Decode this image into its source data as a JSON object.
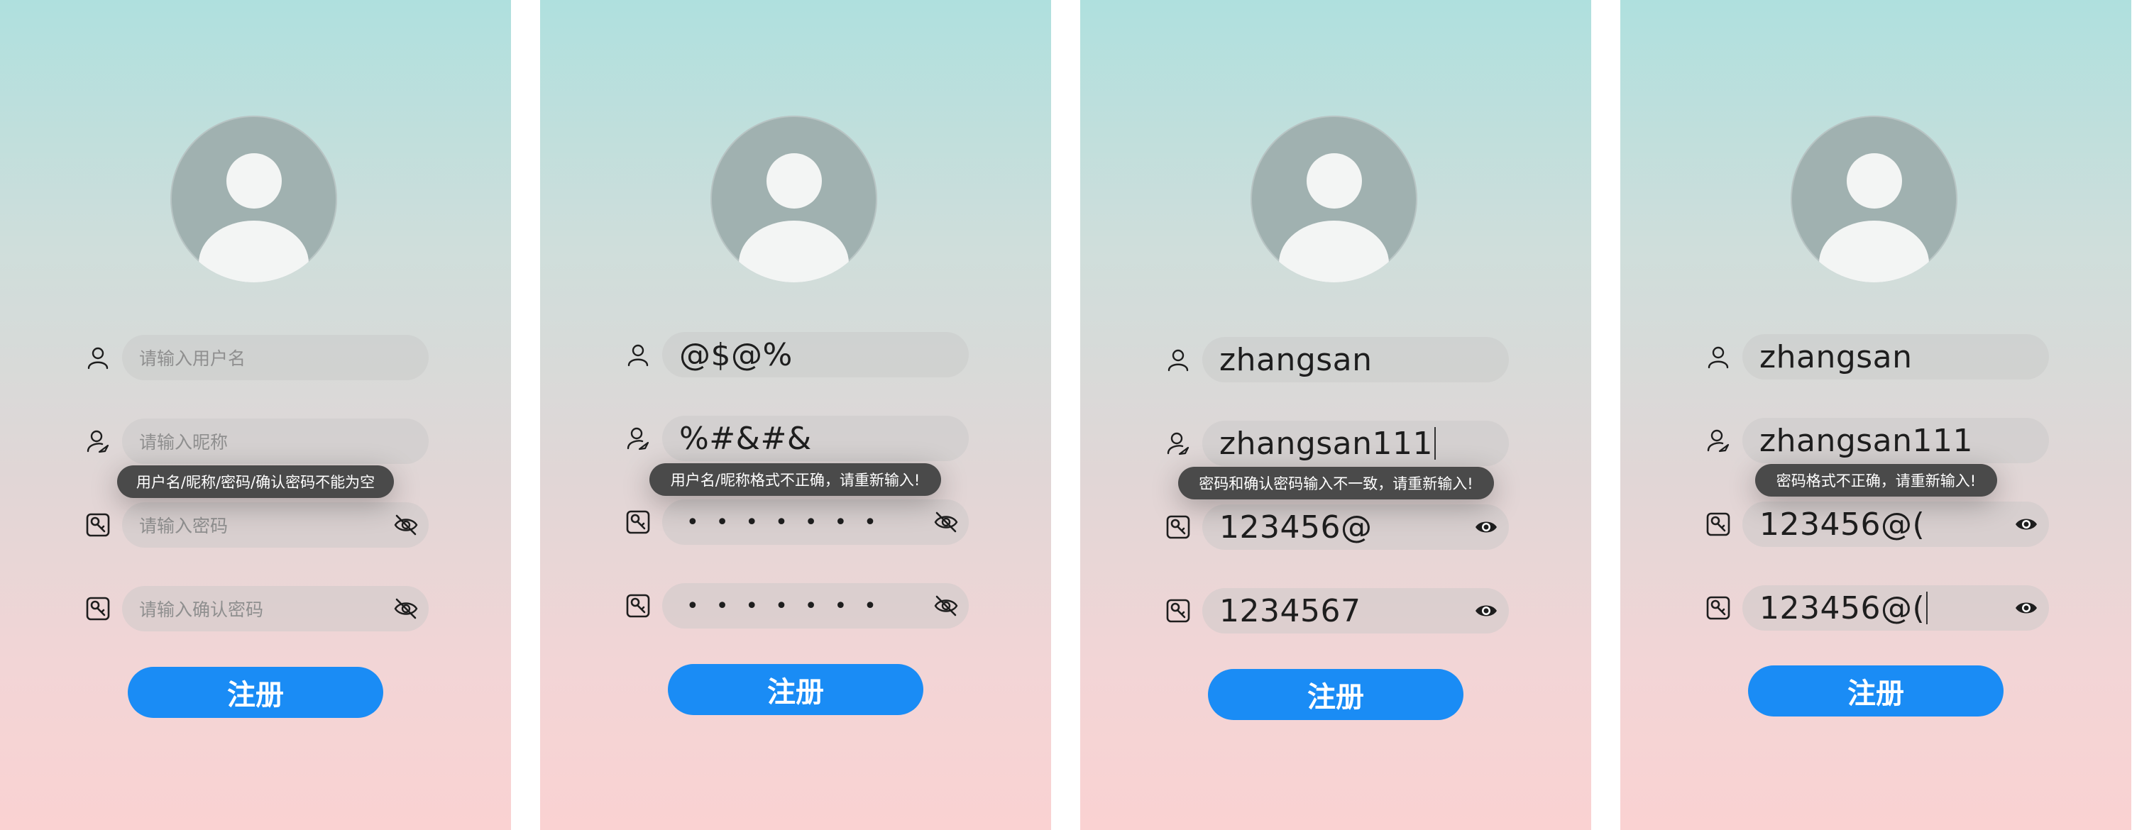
{
  "screens": [
    {
      "fields": [
        {
          "icon": "user-icon",
          "text": "请输入用户名",
          "kind": "placeholder"
        },
        {
          "icon": "user-edit-icon",
          "text": "请输入昵称",
          "kind": "placeholder"
        },
        {
          "icon": "password-icon",
          "text": "请输入密码",
          "kind": "placeholder",
          "eye": "eye-off-icon"
        },
        {
          "icon": "password-icon",
          "text": "请输入确认密码",
          "kind": "placeholder",
          "eye": "eye-off-icon"
        }
      ],
      "toast": "用户名/昵称/密码/确认密码不能为空",
      "button": "注册"
    },
    {
      "fields": [
        {
          "icon": "user-icon",
          "text": "@$@%",
          "kind": "value"
        },
        {
          "icon": "user-edit-icon",
          "text": "%#&#&",
          "kind": "value"
        },
        {
          "icon": "password-icon",
          "text": "•••••••",
          "kind": "masked",
          "eye": "eye-off-icon"
        },
        {
          "icon": "password-icon",
          "text": "•••••••",
          "kind": "masked",
          "eye": "eye-off-icon"
        }
      ],
      "toast": "用户名/昵称格式不正确，请重新输入!",
      "button": "注册"
    },
    {
      "fields": [
        {
          "icon": "user-icon",
          "text": "zhangsan",
          "kind": "value"
        },
        {
          "icon": "user-edit-icon",
          "text": "zhangsan111",
          "kind": "value",
          "caret": true
        },
        {
          "icon": "password-icon",
          "text": "123456@",
          "kind": "value",
          "eye": "eye-icon"
        },
        {
          "icon": "password-icon",
          "text": "1234567",
          "kind": "value",
          "eye": "eye-icon"
        }
      ],
      "toast": "密码和确认密码输入不一致，请重新输入!",
      "button": "注册"
    },
    {
      "fields": [
        {
          "icon": "user-icon",
          "text": "zhangsan",
          "kind": "value"
        },
        {
          "icon": "user-edit-icon",
          "text": "zhangsan111",
          "kind": "value"
        },
        {
          "icon": "password-icon",
          "text": "123456@(",
          "kind": "value",
          "eye": "eye-icon"
        },
        {
          "icon": "password-icon",
          "text": "123456@(",
          "kind": "value",
          "eye": "eye-icon",
          "caret": true
        }
      ],
      "toast": "密码格式不正确，请重新输入!",
      "button": "注册"
    }
  ],
  "colors": {
    "button": "#1a8cf5",
    "toast": "#4a4a4a",
    "text": "#1e1e1e"
  }
}
